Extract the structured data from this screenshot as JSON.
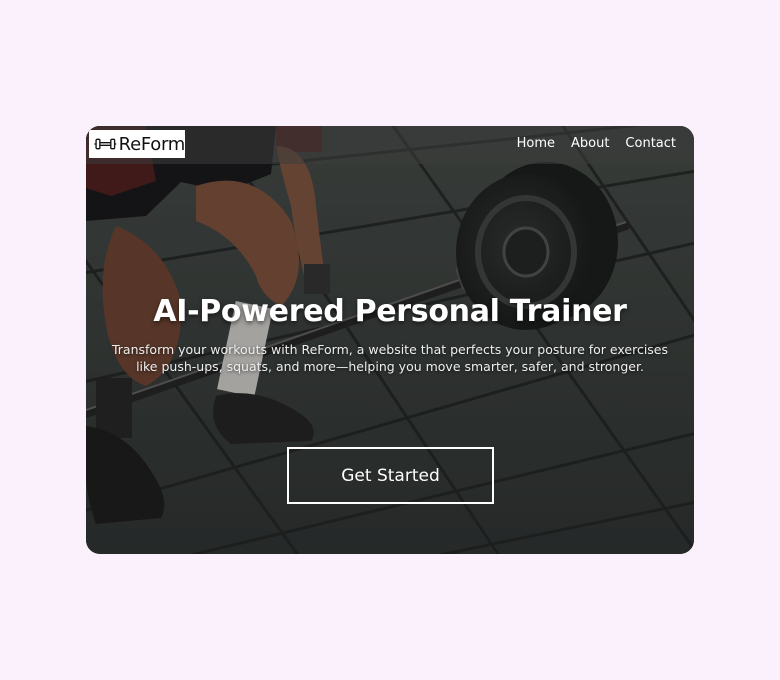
{
  "brand": {
    "name": "ReForm",
    "logo_icon": "dumbbell-icon"
  },
  "nav": {
    "items": [
      {
        "label": "Home"
      },
      {
        "label": "About"
      },
      {
        "label": "Contact"
      }
    ]
  },
  "hero": {
    "title": "AI-Powered Personal Trainer",
    "subtitle": "Transform your workouts with ReForm, a website that perfects your posture for exercises like push-ups, squats, and more—helping you move smarter, safer, and stronger.",
    "cta_label": "Get Started",
    "background": "person-lifting-barbell-photo"
  },
  "colors": {
    "page_background": "#fbf1fd",
    "text": "#ffffff",
    "logo_background": "#ffffff"
  }
}
